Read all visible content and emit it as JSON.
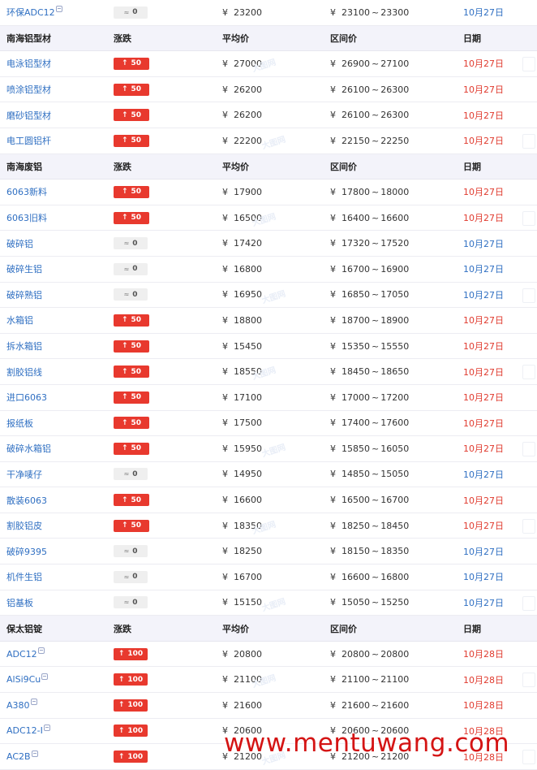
{
  "watermark": {
    "site": "www.mentuwang.com",
    "overlay": "大图网"
  },
  "labels": {
    "currency": "¥",
    "range_sep": "~",
    "up_arrow": "↑",
    "flat_symbol": "≈"
  },
  "rows": [
    {
      "kind": "item",
      "name": "环保ADC12",
      "mark": true,
      "change": "0",
      "trend": "flat",
      "avg": "23200",
      "low": "23100",
      "high": "23300",
      "date": "10月27日",
      "date_color": "blue"
    },
    {
      "kind": "header",
      "title": "南海铝型材",
      "col_change": "涨跌",
      "col_avg": "平均价",
      "col_range": "区间价",
      "col_date": "日期"
    },
    {
      "kind": "item",
      "name": "电泳铝型材",
      "change": "50",
      "trend": "up",
      "avg": "27000",
      "low": "26900",
      "high": "27100",
      "date": "10月27日",
      "date_color": "red"
    },
    {
      "kind": "item",
      "name": "喷涂铝型材",
      "change": "50",
      "trend": "up",
      "avg": "26200",
      "low": "26100",
      "high": "26300",
      "date": "10月27日",
      "date_color": "red"
    },
    {
      "kind": "item",
      "name": "磨砂铝型材",
      "change": "50",
      "trend": "up",
      "avg": "26200",
      "low": "26100",
      "high": "26300",
      "date": "10月27日",
      "date_color": "red"
    },
    {
      "kind": "item",
      "name": "电工圆铝杆",
      "change": "50",
      "trend": "up",
      "avg": "22200",
      "low": "22150",
      "high": "22250",
      "date": "10月27日",
      "date_color": "red"
    },
    {
      "kind": "header",
      "title": "南海废铝",
      "col_change": "涨跌",
      "col_avg": "平均价",
      "col_range": "区间价",
      "col_date": "日期"
    },
    {
      "kind": "item",
      "name": "6063新料",
      "change": "50",
      "trend": "up",
      "avg": "17900",
      "low": "17800",
      "high": "18000",
      "date": "10月27日",
      "date_color": "red"
    },
    {
      "kind": "item",
      "name": "6063旧料",
      "change": "50",
      "trend": "up",
      "avg": "16500",
      "low": "16400",
      "high": "16600",
      "date": "10月27日",
      "date_color": "red"
    },
    {
      "kind": "item",
      "name": "破碎铝",
      "change": "0",
      "trend": "flat",
      "avg": "17420",
      "low": "17320",
      "high": "17520",
      "date": "10月27日",
      "date_color": "blue"
    },
    {
      "kind": "item",
      "name": "破碎生铝",
      "change": "0",
      "trend": "flat",
      "avg": "16800",
      "low": "16700",
      "high": "16900",
      "date": "10月27日",
      "date_color": "blue"
    },
    {
      "kind": "item",
      "name": "破碎熟铝",
      "change": "0",
      "trend": "flat",
      "avg": "16950",
      "low": "16850",
      "high": "17050",
      "date": "10月27日",
      "date_color": "blue"
    },
    {
      "kind": "item",
      "name": "水箱铝",
      "change": "50",
      "trend": "up",
      "avg": "18800",
      "low": "18700",
      "high": "18900",
      "date": "10月27日",
      "date_color": "red"
    },
    {
      "kind": "item",
      "name": "拆水箱铝",
      "change": "50",
      "trend": "up",
      "avg": "15450",
      "low": "15350",
      "high": "15550",
      "date": "10月27日",
      "date_color": "red"
    },
    {
      "kind": "item",
      "name": "割胶铝线",
      "change": "50",
      "trend": "up",
      "avg": "18550",
      "low": "18450",
      "high": "18650",
      "date": "10月27日",
      "date_color": "red"
    },
    {
      "kind": "item",
      "name": "进口6063",
      "change": "50",
      "trend": "up",
      "avg": "17100",
      "low": "17000",
      "high": "17200",
      "date": "10月27日",
      "date_color": "red"
    },
    {
      "kind": "item",
      "name": "报纸板",
      "change": "50",
      "trend": "up",
      "avg": "17500",
      "low": "17400",
      "high": "17600",
      "date": "10月27日",
      "date_color": "red"
    },
    {
      "kind": "item",
      "name": "破碎水箱铝",
      "change": "50",
      "trend": "up",
      "avg": "15950",
      "low": "15850",
      "high": "16050",
      "date": "10月27日",
      "date_color": "red"
    },
    {
      "kind": "item",
      "name": "干净唛仔",
      "change": "0",
      "trend": "flat",
      "avg": "14950",
      "low": "14850",
      "high": "15050",
      "date": "10月27日",
      "date_color": "blue"
    },
    {
      "kind": "item",
      "name": "散装6063",
      "change": "50",
      "trend": "up",
      "avg": "16600",
      "low": "16500",
      "high": "16700",
      "date": "10月27日",
      "date_color": "red"
    },
    {
      "kind": "item",
      "name": "割胶铝皮",
      "change": "50",
      "trend": "up",
      "avg": "18350",
      "low": "18250",
      "high": "18450",
      "date": "10月27日",
      "date_color": "red"
    },
    {
      "kind": "item",
      "name": "破碎9395",
      "change": "0",
      "trend": "flat",
      "avg": "18250",
      "low": "18150",
      "high": "18350",
      "date": "10月27日",
      "date_color": "blue"
    },
    {
      "kind": "item",
      "name": "机件生铝",
      "change": "0",
      "trend": "flat",
      "avg": "16700",
      "low": "16600",
      "high": "16800",
      "date": "10月27日",
      "date_color": "blue"
    },
    {
      "kind": "item",
      "name": "铝基板",
      "change": "0",
      "trend": "flat",
      "avg": "15150",
      "low": "15050",
      "high": "15250",
      "date": "10月27日",
      "date_color": "blue"
    },
    {
      "kind": "header",
      "title": "保太铝锭",
      "col_change": "涨跌",
      "col_avg": "平均价",
      "col_range": "区间价",
      "col_date": "日期"
    },
    {
      "kind": "item",
      "name": "ADC12",
      "mark": true,
      "change": "100",
      "trend": "up",
      "avg": "20800",
      "low": "20800",
      "high": "20800",
      "date": "10月28日",
      "date_color": "red"
    },
    {
      "kind": "item",
      "name": "AlSi9Cu",
      "mark": true,
      "change": "100",
      "trend": "up",
      "avg": "21100",
      "low": "21100",
      "high": "21100",
      "date": "10月28日",
      "date_color": "red"
    },
    {
      "kind": "item",
      "name": "A380",
      "mark": true,
      "change": "100",
      "trend": "up",
      "avg": "21600",
      "low": "21600",
      "high": "21600",
      "date": "10月28日",
      "date_color": "red"
    },
    {
      "kind": "item",
      "name": "ADC12-I",
      "mark": true,
      "change": "100",
      "trend": "up",
      "avg": "20600",
      "low": "20600",
      "high": "20600",
      "date": "10月28日",
      "date_color": "red"
    },
    {
      "kind": "item",
      "name": "AC2B",
      "mark": true,
      "change": "100",
      "trend": "up",
      "avg": "21200",
      "low": "21200",
      "high": "21200",
      "date": "10月28日",
      "date_color": "red"
    }
  ]
}
